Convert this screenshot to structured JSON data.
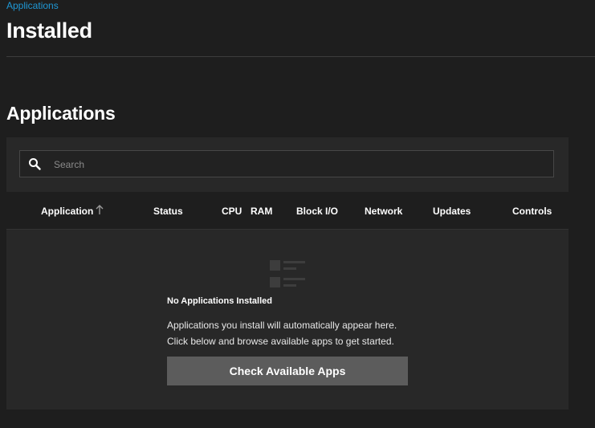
{
  "breadcrumb": {
    "label": "Applications"
  },
  "page": {
    "title": "Installed"
  },
  "section": {
    "title": "Applications"
  },
  "search": {
    "placeholder": "Search",
    "icon": "search-icon"
  },
  "table": {
    "columns": [
      {
        "key": "application",
        "label": "Application",
        "sort": "ascending"
      },
      {
        "key": "status",
        "label": "Status"
      },
      {
        "key": "cpu",
        "label": "CPU"
      },
      {
        "key": "ram",
        "label": "RAM"
      },
      {
        "key": "block_io",
        "label": "Block I/O"
      },
      {
        "key": "network",
        "label": "Network"
      },
      {
        "key": "updates",
        "label": "Updates"
      },
      {
        "key": "controls",
        "label": "Controls"
      }
    ]
  },
  "empty_state": {
    "icon": "list-icon",
    "title": "No Applications Installed",
    "line1": "Applications you install will automatically appear here.",
    "line2": "Click below and browse available apps to get started.",
    "button_label": "Check Available Apps"
  },
  "colors": {
    "background": "#1e1e1e",
    "panel": "#282828",
    "accent_link": "#1f98d6",
    "button": "#5c5c5c"
  }
}
